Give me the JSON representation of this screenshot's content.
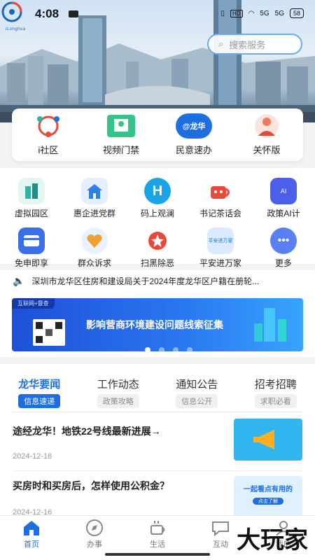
{
  "status_bar": {
    "time": "4:08",
    "network_hd": "HD",
    "signal_1": "5G",
    "signal_2": "5G",
    "battery": "58",
    "logo_text": "iLonghua"
  },
  "search": {
    "placeholder": "搜索服务"
  },
  "quick_items": [
    {
      "label": "i社区",
      "icon": "community-icon"
    },
    {
      "label": "视频门禁",
      "icon": "video-access-icon"
    },
    {
      "label": "民意速办",
      "icon": "public-opinion-icon",
      "badge": "@龙华"
    },
    {
      "label": "关怀版",
      "icon": "elder-care-icon"
    }
  ],
  "services": [
    {
      "label": "虚拟园区",
      "icon": "virtual-park-icon",
      "color": "#2bb3a3"
    },
    {
      "label": "惠企进党群",
      "icon": "building-icon",
      "color": "#2f7fe8"
    },
    {
      "label": "码上观澜",
      "icon": "h-logo-icon",
      "color": "#1aa4e8"
    },
    {
      "label": "书记茶话会",
      "icon": "tea-cup-icon",
      "color": "#e84a3a"
    },
    {
      "label": "政策AI计",
      "icon": "policy-ai-icon",
      "color": "#4b5fe8"
    },
    {
      "label": "免申即享",
      "icon": "card-icon",
      "color": "#3a6fe8"
    },
    {
      "label": "群众诉求",
      "icon": "heart-hand-icon",
      "color": "#1d8fe0"
    },
    {
      "label": "扫黑除恶",
      "icon": "star-shield-icon",
      "color": "#e8473a"
    },
    {
      "label": "平安进万家",
      "icon": "safety-icon",
      "color": "#6fa8e8",
      "inner_text": "平安进万家"
    },
    {
      "label": "更多",
      "icon": "more-icon",
      "color": "#5a7ff0"
    }
  ],
  "notice": {
    "text": "深圳市龙华区住房和建设局关于2024年度龙华区户籍在册轮..."
  },
  "banner": {
    "tag": "互联网+督查",
    "title": "影响营商环境建设问题线索征集",
    "slides": 4,
    "active_slide": 0
  },
  "news_tabs": [
    {
      "title": "龙华要闻",
      "sub": "信息速递"
    },
    {
      "title": "工作动态",
      "sub": "政策攻略"
    },
    {
      "title": "通知公告",
      "sub": "信息公开"
    },
    {
      "title": "招考招聘",
      "sub": "求职必看"
    }
  ],
  "articles": [
    {
      "title": "途经龙华！地铁22号线最新进展→",
      "date": "2024-12-18"
    },
    {
      "title": "买房时和买房后，怎样使用公积金？",
      "date": "2024-12-16",
      "thumb_text": "一起看点有用的",
      "thumb_btn": "点击了解"
    }
  ],
  "bottom_nav": [
    {
      "label": "首页",
      "icon": "home-icon"
    },
    {
      "label": "办事",
      "icon": "compass-icon"
    },
    {
      "label": "生活",
      "icon": "coffee-icon"
    },
    {
      "label": "互动",
      "icon": "chat-icon"
    },
    {
      "label": "我的",
      "icon": "user-icon"
    }
  ],
  "watermark": "大玩家",
  "colors": {
    "primary": "#1d6fe0",
    "banner": "#2a78f0"
  }
}
